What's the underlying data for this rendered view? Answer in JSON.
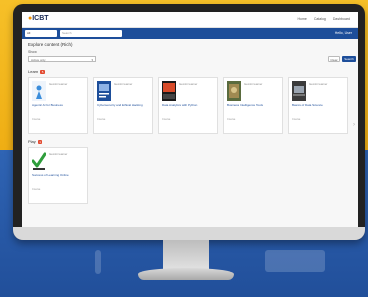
{
  "colors": {
    "background_top": "#f2b41a",
    "background_bottom": "#214f9a",
    "navbar": "#1d4e9a",
    "badge": "#e2492f",
    "check_green": "#2e9d3b"
  },
  "topbar": {
    "logo": "ICBT",
    "nav_items": [
      "Home",
      "Catalog",
      "Dashboard"
    ]
  },
  "navbar": {
    "select_value": "All",
    "search_placeholder": "Search",
    "search_icon": "search-icon",
    "right_text": "Hello, User"
  },
  "page": {
    "title": "Explore content (Rich)",
    "show_label": "Show",
    "filter_value": "Active only",
    "clear_button": "Clear",
    "search_button": "Search"
  },
  "sections": [
    {
      "name": "Learn",
      "count": "5",
      "cards": [
        {
          "thumb": "figure-thumb",
          "subtitle": "Gemini learner",
          "title": "Agentic AI for Business",
          "meta": "Course"
        },
        {
          "thumb": "book-thumb",
          "subtitle": "Gemini learner",
          "title": "Cybersecurity and Ethical Hacking",
          "meta": "Course"
        },
        {
          "thumb": "video-thumb",
          "subtitle": "Gemini learner",
          "title": "Data Analytics with Python",
          "meta": "Course"
        },
        {
          "thumb": "photo-thumb",
          "subtitle": "Gemini learner",
          "title": "Business Intelligence Tools",
          "meta": "Course"
        },
        {
          "thumb": "laptop-thumb",
          "subtitle": "Gemini learner",
          "title": "Basics of Data Science",
          "meta": "Course"
        }
      ]
    },
    {
      "name": "Play",
      "count": "1",
      "cards": [
        {
          "thumb": "checkmark-thumb",
          "subtitle": "Gemini learner",
          "title": "Success of Learning Online",
          "meta": "Course"
        }
      ]
    }
  ]
}
